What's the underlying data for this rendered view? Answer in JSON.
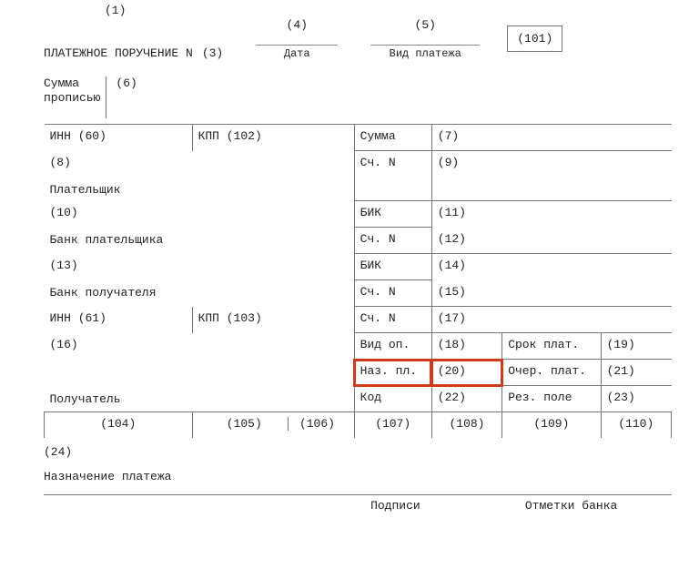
{
  "header": {
    "ref1": "(1)",
    "title": "ПЛАТЕЖНОЕ ПОРУЧЕНИЕ N",
    "ref3": "(3)",
    "ref4": "(4)",
    "ref5": "(5)",
    "date_label": "Дата",
    "type_label": "Вид платежа",
    "ref101": "(101)"
  },
  "sum": {
    "label1": "Сумма",
    "label2": "прописью",
    "ref6": "(6)"
  },
  "rows": {
    "inn60": "ИНН (60)",
    "kpp102": "КПП (102)",
    "sum": "Сумма",
    "r7": "(7)",
    "r8": "(8)",
    "payer": "Плательщик",
    "schN": "Сч. N",
    "r9": "(9)",
    "r10": "(10)",
    "bik": "БИК",
    "r11": "(11)",
    "r12": "(12)",
    "bank_payer": "Банк плательщика",
    "r13": "(13)",
    "r14": "(14)",
    "r15": "(15)",
    "bank_recv": "Банк получателя",
    "inn61": "ИНН (61)",
    "kpp103": "КПП (103)",
    "r17": "(17)",
    "r16": "(16)",
    "vid_op": "Вид оп.",
    "r18": "(18)",
    "srok": "Срок плат.",
    "r19": "(19)",
    "naz_pl": "Наз. пл.",
    "r20": "(20)",
    "ocher": "Очер. плат.",
    "r21": "(21)",
    "recv": "Получатель",
    "kod": "Код",
    "r22": "(22)",
    "rez": "Рез. поле",
    "r23": "(23)"
  },
  "codes": {
    "c104": "(104)",
    "c105": "(105)",
    "c106": "(106)",
    "c107": "(107)",
    "c108": "(108)",
    "c109": "(109)",
    "c110": "(110)"
  },
  "footer": {
    "r24": "(24)",
    "purpose": "Назначение платежа",
    "sign": "Подписи",
    "bank_marks": "Отметки банка"
  }
}
